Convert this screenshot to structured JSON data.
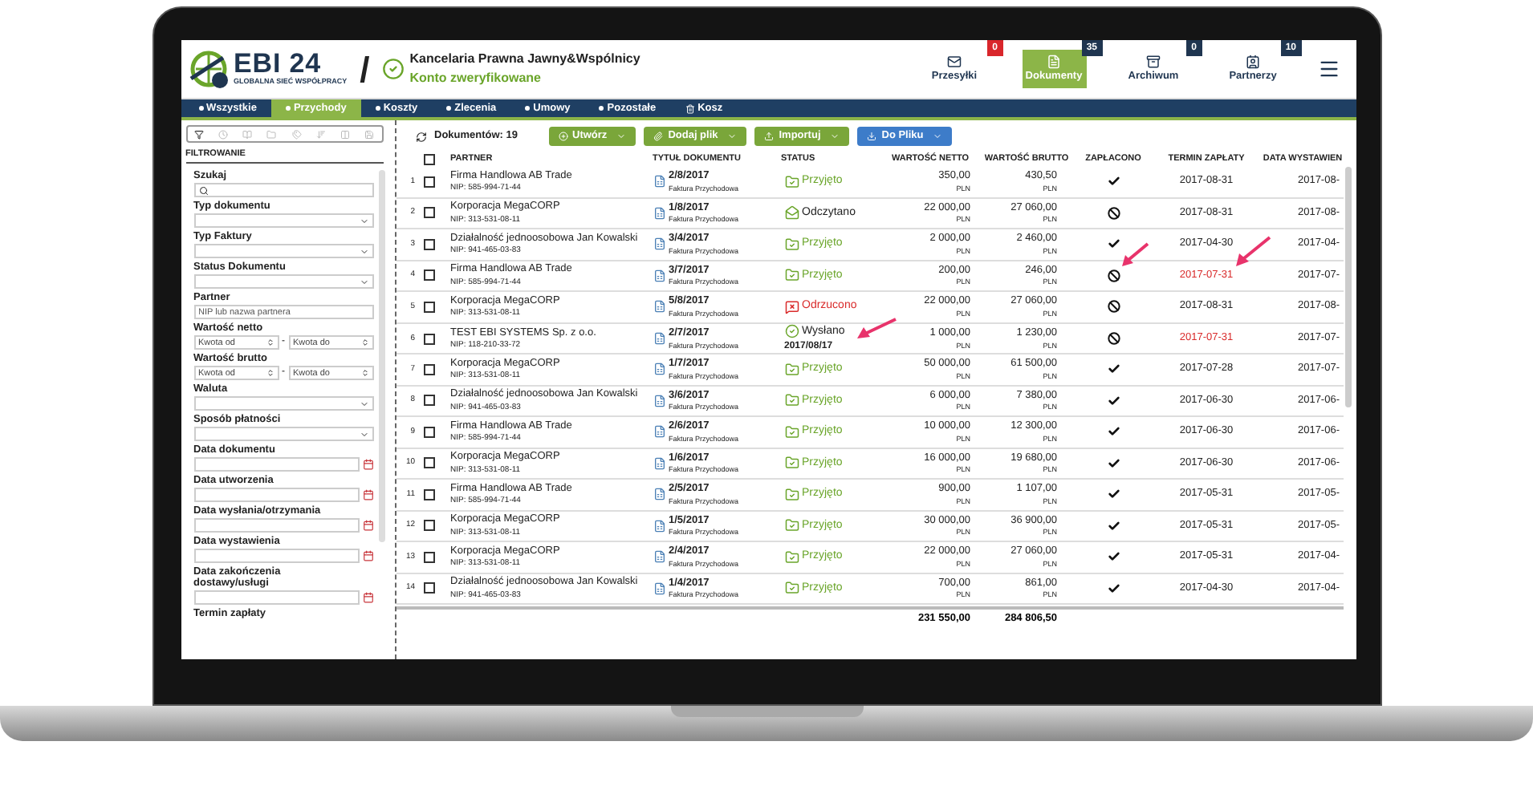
{
  "header": {
    "logo_text": "EBI 24",
    "logo_tagline": "GLOBALNA SIEĆ WSPÓŁPRACY",
    "separator": "/",
    "company": "Kancelaria Prawna Jawny&Wspólnicy",
    "verified": "Konto zweryfikowane",
    "nav": [
      {
        "kind": "mail",
        "label": "Przesyłki",
        "badge": "0",
        "color": "#d9262b",
        "selected": false
      },
      {
        "kind": "document",
        "label": "Dokumenty",
        "badge": "35",
        "color": "#1f3550",
        "selected": true
      },
      {
        "kind": "archive",
        "label": "Archiwum",
        "badge": "0",
        "color": "#1f3550",
        "selected": false
      },
      {
        "kind": "contacts",
        "label": "Partnerzy",
        "badge": "10",
        "color": "#1f3550",
        "selected": false
      }
    ]
  },
  "tabs": [
    {
      "label": "Wszystkie",
      "kind": "dot",
      "selected": false
    },
    {
      "label": "Przychody",
      "kind": "dot",
      "selected": true
    },
    {
      "label": "Koszty",
      "kind": "dot",
      "selected": false
    },
    {
      "label": "Zlecenia",
      "kind": "dot",
      "selected": false
    },
    {
      "label": "Umowy",
      "kind": "dot",
      "selected": false
    },
    {
      "label": "Pozostałe",
      "kind": "dot",
      "selected": false
    },
    {
      "label": "Kosz",
      "kind": "trash",
      "selected": false
    }
  ],
  "sidebar": {
    "tools": [
      {
        "kind": "filter",
        "selected": true
      },
      {
        "kind": "clock",
        "selected": false
      },
      {
        "kind": "book",
        "selected": false
      },
      {
        "kind": "folder",
        "selected": false
      },
      {
        "kind": "tags",
        "selected": false
      },
      {
        "kind": "sort",
        "selected": false
      },
      {
        "kind": "columns",
        "selected": false
      },
      {
        "kind": "save",
        "selected": false
      }
    ],
    "heading": "FILTROWANIE",
    "filters": [
      {
        "label": "Szukaj",
        "kind": "search"
      },
      {
        "label": "Typ dokumentu",
        "kind": "select"
      },
      {
        "label": "Typ Faktury",
        "kind": "select"
      },
      {
        "label": "Status Dokumentu",
        "kind": "select"
      },
      {
        "label": "Partner",
        "kind": "text",
        "placeholder": "NIP lub nazwa partnera"
      },
      {
        "label": "Wartość netto",
        "kind": "range",
        "from": "Kwota od",
        "separator": "-",
        "to": "Kwota do"
      },
      {
        "label": "Wartość brutto",
        "kind": "range",
        "from": "Kwota od",
        "separator": "-",
        "to": "Kwota do"
      },
      {
        "label": "Waluta",
        "kind": "select"
      },
      {
        "label": "Sposób płatności",
        "kind": "select"
      },
      {
        "label": "Data dokumentu",
        "kind": "date"
      },
      {
        "label": "Data utworzenia",
        "kind": "date"
      },
      {
        "label": "Data wysłania/otrzymania",
        "kind": "date"
      },
      {
        "label": "Data wystawienia",
        "kind": "date"
      },
      {
        "label": "Data zakończenia dostawy/usługi",
        "kind": "date"
      },
      {
        "label": "Termin zapłaty",
        "kind": "label"
      }
    ]
  },
  "toolbar": {
    "count": "Dokumentów: 19",
    "buttons": [
      {
        "kind": "create",
        "label": "Utwórz",
        "color": "#7aa63a"
      },
      {
        "kind": "attach",
        "label": "Dodaj plik",
        "color": "#7aa63a"
      },
      {
        "kind": "import",
        "label": "Importuj",
        "color": "#7aa63a"
      },
      {
        "kind": "export",
        "label": "Do Pliku",
        "color": "#3d7cc9"
      }
    ]
  },
  "table": {
    "select_all_checked": false,
    "columns": [
      "PARTNER",
      "TYTUŁ DOKUMENTU",
      "STATUS",
      "WARTOŚĆ NETTO",
      "WARTOŚĆ BRUTTO",
      "ZAPŁACONO",
      "TERMIN ZAPŁATY",
      "DATA WYSTAWIEN"
    ],
    "rows": [
      {
        "no": "1",
        "checked": false,
        "partner": "Firma Handlowa AB Trade",
        "nip": "NIP: 585-994-71-44",
        "title": "2/8/2017",
        "type": "Faktura Przychodowa",
        "status": {
          "kind": "accepted",
          "label": "Przyjęto"
        },
        "net": "350,00",
        "net_currency": "PLN",
        "gross": "430,50",
        "gross_currency": "PLN",
        "paid": true,
        "due": "2017-08-31",
        "overdue": false,
        "issued": "2017-08-"
      },
      {
        "no": "2",
        "checked": false,
        "partner": "Korporacja MegaCORP",
        "nip": "NIP: 313-531-08-11",
        "title": "1/8/2017",
        "type": "Faktura Przychodowa",
        "status": {
          "kind": "read",
          "label": "Odczytano"
        },
        "net": "22 000,00",
        "net_currency": "PLN",
        "gross": "27 060,00",
        "gross_currency": "PLN",
        "paid": false,
        "due": "2017-08-31",
        "overdue": false,
        "issued": "2017-08-"
      },
      {
        "no": "3",
        "checked": false,
        "partner": "Działalność jednoosobowa Jan Kowalski",
        "nip": "NIP: 941-465-03-83",
        "title": "3/4/2017",
        "type": "Faktura Przychodowa",
        "status": {
          "kind": "accepted",
          "label": "Przyjęto"
        },
        "net": "2 000,00",
        "net_currency": "PLN",
        "gross": "2 460,00",
        "gross_currency": "PLN",
        "paid": true,
        "due": "2017-04-30",
        "overdue": false,
        "issued": "2017-04-"
      },
      {
        "no": "4",
        "checked": false,
        "partner": "Firma Handlowa AB Trade",
        "nip": "NIP: 585-994-71-44",
        "title": "3/7/2017",
        "type": "Faktura Przychodowa",
        "status": {
          "kind": "accepted",
          "label": "Przyjęto"
        },
        "net": "200,00",
        "net_currency": "PLN",
        "gross": "246,00",
        "gross_currency": "PLN",
        "paid": false,
        "due": "2017-07-31",
        "overdue": true,
        "issued": "2017-07-"
      },
      {
        "no": "5",
        "checked": false,
        "partner": "Korporacja MegaCORP",
        "nip": "NIP: 313-531-08-11",
        "title": "5/8/2017",
        "type": "Faktura Przychodowa",
        "status": {
          "kind": "rejected",
          "label": "Odrzucono"
        },
        "net": "22 000,00",
        "net_currency": "PLN",
        "gross": "27 060,00",
        "gross_currency": "PLN",
        "paid": false,
        "due": "2017-08-31",
        "overdue": false,
        "issued": "2017-08-"
      },
      {
        "no": "6",
        "checked": false,
        "partner": "TEST EBI SYSTEMS Sp. z o.o.",
        "nip": "NIP: 118-210-33-72",
        "title": "2/7/2017",
        "type": "Faktura Przychodowa",
        "status": {
          "kind": "sent",
          "label": "Wysłano",
          "date": "2017/08/17"
        },
        "net": "1 000,00",
        "net_currency": "PLN",
        "gross": "1 230,00",
        "gross_currency": "PLN",
        "paid": false,
        "due": "2017-07-31",
        "overdue": true,
        "issued": "2017-07-"
      },
      {
        "no": "7",
        "checked": false,
        "partner": "Korporacja MegaCORP",
        "nip": "NIP: 313-531-08-11",
        "title": "1/7/2017",
        "type": "Faktura Przychodowa",
        "status": {
          "kind": "accepted",
          "label": "Przyjęto"
        },
        "net": "50 000,00",
        "net_currency": "PLN",
        "gross": "61 500,00",
        "gross_currency": "PLN",
        "paid": true,
        "due": "2017-07-28",
        "overdue": false,
        "issued": "2017-07-"
      },
      {
        "no": "8",
        "checked": false,
        "partner": "Działalność jednoosobowa Jan Kowalski",
        "nip": "NIP: 941-465-03-83",
        "title": "3/6/2017",
        "type": "Faktura Przychodowa",
        "status": {
          "kind": "accepted",
          "label": "Przyjęto"
        },
        "net": "6 000,00",
        "net_currency": "PLN",
        "gross": "7 380,00",
        "gross_currency": "PLN",
        "paid": true,
        "due": "2017-06-30",
        "overdue": false,
        "issued": "2017-06-"
      },
      {
        "no": "9",
        "checked": false,
        "partner": "Firma Handlowa AB Trade",
        "nip": "NIP: 585-994-71-44",
        "title": "2/6/2017",
        "type": "Faktura Przychodowa",
        "status": {
          "kind": "accepted",
          "label": "Przyjęto"
        },
        "net": "10 000,00",
        "net_currency": "PLN",
        "gross": "12 300,00",
        "gross_currency": "PLN",
        "paid": true,
        "due": "2017-06-30",
        "overdue": false,
        "issued": "2017-06-"
      },
      {
        "no": "10",
        "checked": false,
        "partner": "Korporacja MegaCORP",
        "nip": "NIP: 313-531-08-11",
        "title": "1/6/2017",
        "type": "Faktura Przychodowa",
        "status": {
          "kind": "accepted",
          "label": "Przyjęto"
        },
        "net": "16 000,00",
        "net_currency": "PLN",
        "gross": "19 680,00",
        "gross_currency": "PLN",
        "paid": true,
        "due": "2017-06-30",
        "overdue": false,
        "issued": "2017-06-"
      },
      {
        "no": "11",
        "checked": false,
        "partner": "Firma Handlowa AB Trade",
        "nip": "NIP: 585-994-71-44",
        "title": "2/5/2017",
        "type": "Faktura Przychodowa",
        "status": {
          "kind": "accepted",
          "label": "Przyjęto"
        },
        "net": "900,00",
        "net_currency": "PLN",
        "gross": "1 107,00",
        "gross_currency": "PLN",
        "paid": true,
        "due": "2017-05-31",
        "overdue": false,
        "issued": "2017-05-"
      },
      {
        "no": "12",
        "checked": false,
        "partner": "Korporacja MegaCORP",
        "nip": "NIP: 313-531-08-11",
        "title": "1/5/2017",
        "type": "Faktura Przychodowa",
        "status": {
          "kind": "accepted",
          "label": "Przyjęto"
        },
        "net": "30 000,00",
        "net_currency": "PLN",
        "gross": "36 900,00",
        "gross_currency": "PLN",
        "paid": true,
        "due": "2017-05-31",
        "overdue": false,
        "issued": "2017-05-"
      },
      {
        "no": "13",
        "checked": false,
        "partner": "Korporacja MegaCORP",
        "nip": "NIP: 313-531-08-11",
        "title": "2/4/2017",
        "type": "Faktura Przychodowa",
        "status": {
          "kind": "accepted",
          "label": "Przyjęto"
        },
        "net": "22 000,00",
        "net_currency": "PLN",
        "gross": "27 060,00",
        "gross_currency": "PLN",
        "paid": true,
        "due": "2017-05-31",
        "overdue": false,
        "issued": "2017-04-"
      },
      {
        "no": "14",
        "checked": false,
        "partner": "Działalność jednoosobowa Jan Kowalski",
        "nip": "NIP: 941-465-03-83",
        "title": "1/4/2017",
        "type": "Faktura Przychodowa",
        "status": {
          "kind": "accepted",
          "label": "Przyjęto"
        },
        "net": "700,00",
        "net_currency": "PLN",
        "gross": "861,00",
        "gross_currency": "PLN",
        "paid": true,
        "due": "2017-04-30",
        "overdue": false,
        "issued": "2017-04-"
      }
    ],
    "totals": {
      "net": "231 550,00",
      "gross": "284 806,50"
    }
  }
}
